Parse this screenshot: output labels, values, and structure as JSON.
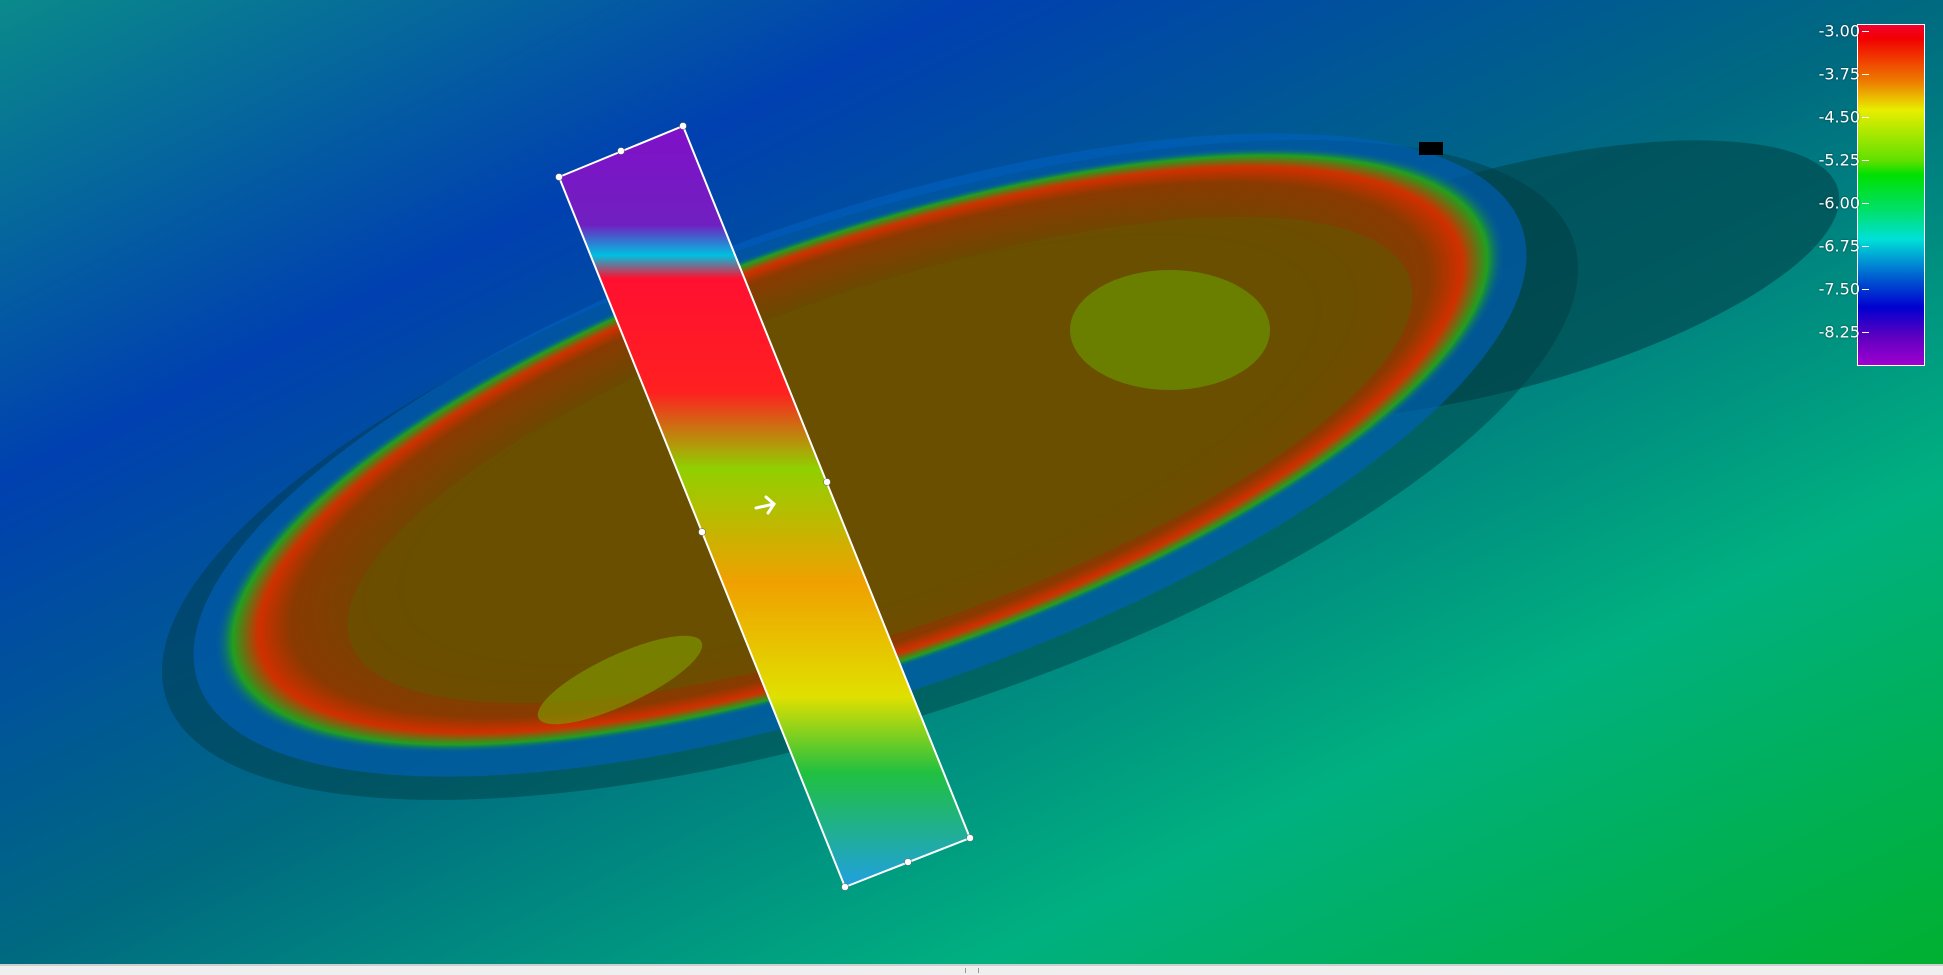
{
  "legend": {
    "title": "depth color scale",
    "ticks": [
      "-3.00",
      "-3.75",
      "-4.50",
      "-5.25",
      "-6.00",
      "-6.75",
      "-7.50",
      "-8.25"
    ],
    "colors": {
      "max": "#f00030",
      "mid": "#00e000",
      "min": "#a000d0"
    }
  },
  "view": {
    "type": "bathymetry-3d-view",
    "selection": "swath-selection-polygon",
    "cursor": "arrow-cursor"
  }
}
